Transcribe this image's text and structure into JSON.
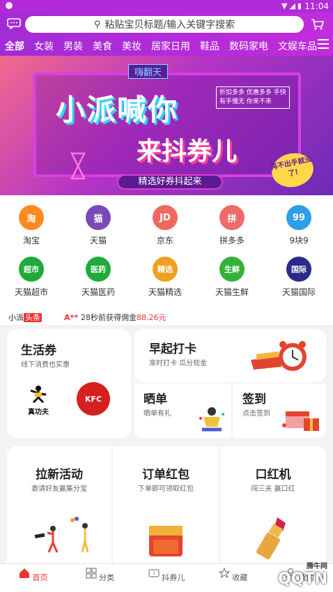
{
  "status_bar": {
    "time": "11:04"
  },
  "search": {
    "placeholder": "粘贴宝贝标题/输入关键字搜索"
  },
  "categories": [
    "全部",
    "女装",
    "男装",
    "美食",
    "美妆",
    "居家日用",
    "鞋品",
    "数码家电",
    "文娱车品"
  ],
  "banner": {
    "tag": "嗨翻天",
    "title_line1": "小派喊你",
    "title_line2": "来抖券儿",
    "side_note": "折扣多多 优惠多多 手快有手慢无 你来不来",
    "ribbon": "精选好券抖起来",
    "bubble": "再不出手就没了!",
    "slide_count": 5,
    "active_slide": 3
  },
  "channels": [
    {
      "label": "淘宝",
      "icon": "淘",
      "color": "#ff8a1f"
    },
    {
      "label": "天猫",
      "icon": "猫",
      "color": "#7a4ab8"
    },
    {
      "label": "京东",
      "icon": "JD",
      "color": "#f0685f"
    },
    {
      "label": "拼多多",
      "icon": "拼",
      "color": "#f06a6a"
    },
    {
      "label": "9块9",
      "icon": "99",
      "color": "#2f9ee8"
    },
    {
      "label": "天猫超市",
      "icon": "超市",
      "color": "#1faa3a"
    },
    {
      "label": "天猫医药",
      "icon": "医药",
      "color": "#1faa3a"
    },
    {
      "label": "天猫精选",
      "icon": "精选",
      "color": "#f0a020"
    },
    {
      "label": "天猫生鲜",
      "icon": "生鲜",
      "color": "#33b23a"
    },
    {
      "label": "天猫国际",
      "icon": "国际",
      "color": "#2a2a8a"
    }
  ],
  "ticker": {
    "brand_a": "小派",
    "brand_b": "头条",
    "user": "A**",
    "text": "28秒前获得佣金",
    "amount": "88.26元"
  },
  "cards1": {
    "life": {
      "title": "生活券",
      "sub": "线下消费也实惠",
      "brand1": "真功夫",
      "brand2": "KFC"
    },
    "morning": {
      "title": "早起打卡",
      "sub": "准时打卡 瓜分现金"
    },
    "show": {
      "title": "晒单",
      "sub": "晒单有礼"
    },
    "sign": {
      "title": "签到",
      "sub": "点击签到"
    }
  },
  "cards2": {
    "invite": {
      "title": "拉新活动",
      "sub": "邀请好友赢集分宝"
    },
    "order": {
      "title": "订单红包",
      "sub": "下单即可领取红包"
    },
    "lipstick": {
      "title": "口红机",
      "sub": "闯三关 赢口红"
    }
  },
  "tabs": [
    "首页",
    "分类",
    "抖券儿",
    "收藏",
    "我的"
  ],
  "watermark": {
    "main": "QQTN",
    "sub": "腾牛网"
  },
  "colors": {
    "accent": "#b12bd8",
    "highlight": "#e33333"
  }
}
